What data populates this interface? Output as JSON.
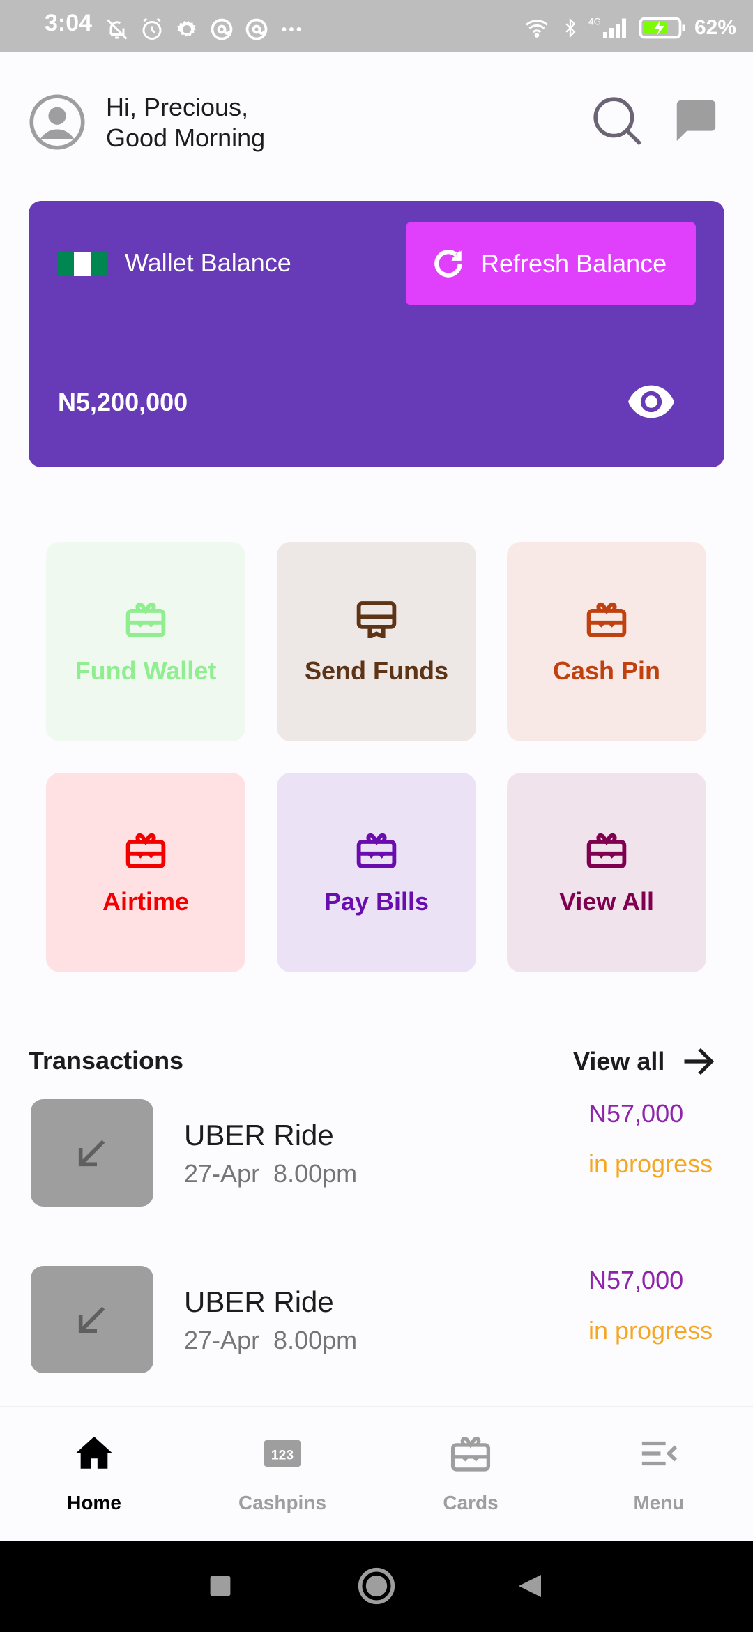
{
  "status_bar": {
    "time": "3:04",
    "battery": "62%",
    "network": "4G",
    "icons_left": [
      "notifications-off-icon",
      "alarm-icon",
      "settings-icon",
      "at-sign-icon",
      "at-sign-icon",
      "more-icon"
    ],
    "icons_right": [
      "wifi-icon",
      "bluetooth-icon",
      "signal-icon",
      "battery-charging-icon"
    ]
  },
  "header": {
    "greeting_line1": "Hi, Precious,",
    "greeting_line2": "Good Morning",
    "avatar_icon": "account-circle-icon",
    "search_icon": "search-icon",
    "chat_icon": "chat-icon"
  },
  "wallet": {
    "label": "Wallet Balance",
    "refresh_label": "Refresh Balance",
    "balance": "N5,200,000",
    "flag_colors": [
      "#008751",
      "#ffffff",
      "#008751"
    ],
    "card_color": "#673ab7",
    "refresh_color": "#e040fb"
  },
  "actions": [
    {
      "label": "Fund Wallet",
      "icon": "card-giftcard-icon",
      "bg": "#eff9ef",
      "color": "#90ee90"
    },
    {
      "label": "Send Funds",
      "icon": "card-membership-icon",
      "bg": "#ede7e6",
      "color": "#5d3415"
    },
    {
      "label": "Cash Pin",
      "icon": "card-giftcard-icon",
      "bg": "#f8e9e6",
      "color": "#c0400f"
    },
    {
      "label": "Airtime",
      "icon": "card-giftcard-icon",
      "bg": "#ffe1e4",
      "color": "#f20000"
    },
    {
      "label": "Pay Bills",
      "icon": "card-giftcard-icon",
      "bg": "#ece2f6",
      "color": "#6a0dad"
    },
    {
      "label": "View All",
      "icon": "card-giftcard-icon",
      "bg": "#f1e3ec",
      "color": "#800050"
    }
  ],
  "transactions": {
    "title": "Transactions",
    "view_all": "View all",
    "items": [
      {
        "name": "UBER Ride",
        "date": "27-Apr  8.00pm",
        "amount": "N57,000",
        "status": "in progress"
      },
      {
        "name": "UBER Ride",
        "date": "27-Apr  8.00pm",
        "amount": "N57,000",
        "status": "in progress"
      }
    ]
  },
  "bottom_nav": {
    "items": [
      {
        "label": "Home",
        "icon": "home-icon",
        "active": true
      },
      {
        "label": "Cashpins",
        "icon": "pin-123-icon",
        "active": false
      },
      {
        "label": "Cards",
        "icon": "card-giftcard-icon",
        "active": false
      },
      {
        "label": "Menu",
        "icon": "menu-open-icon",
        "active": false
      }
    ]
  },
  "system_nav": {
    "buttons": [
      "recents-button",
      "home-button",
      "back-button"
    ]
  }
}
